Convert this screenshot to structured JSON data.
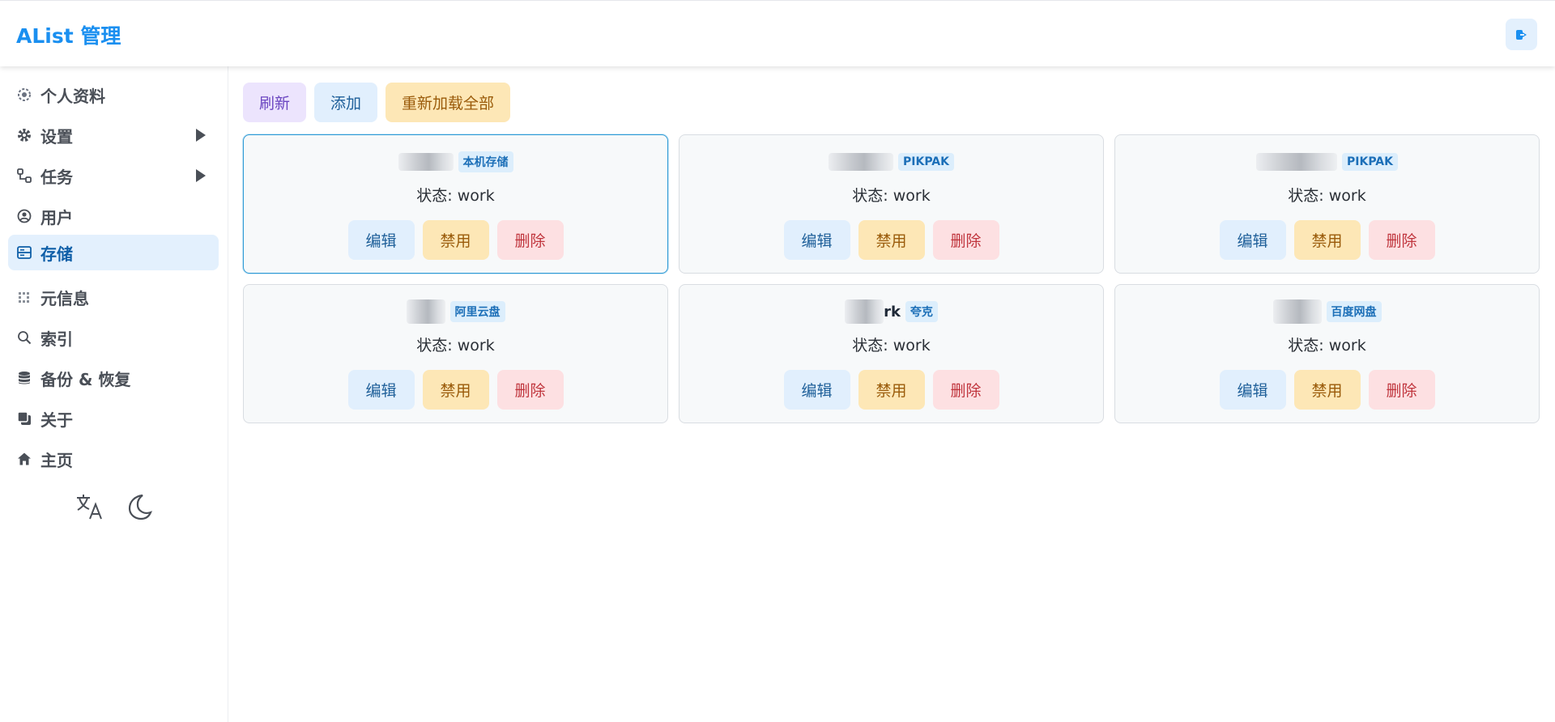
{
  "header": {
    "title": "AList 管理"
  },
  "sidebar": {
    "items": [
      {
        "label": "个人资料",
        "icon": "user-cog-icon",
        "has_submenu": false
      },
      {
        "label": "设置",
        "icon": "gear-icon",
        "has_submenu": true
      },
      {
        "label": "任务",
        "icon": "flow-icon",
        "has_submenu": true
      },
      {
        "label": "用户",
        "icon": "user-circle-icon",
        "has_submenu": false
      },
      {
        "label": "存储",
        "icon": "storage-icon",
        "has_submenu": false,
        "active": true
      },
      {
        "label": "元信息",
        "icon": "meta-grid-icon",
        "has_submenu": false
      },
      {
        "label": "索引",
        "icon": "search-icon",
        "has_submenu": false
      },
      {
        "label": "备份 & 恢复",
        "icon": "database-icon",
        "has_submenu": false
      },
      {
        "label": "关于",
        "icon": "copy-icon",
        "has_submenu": false
      },
      {
        "label": "主页",
        "icon": "home-icon",
        "has_submenu": false
      }
    ]
  },
  "toolbar": {
    "refresh_label": "刷新",
    "add_label": "添加",
    "reload_all_label": "重新加载全部"
  },
  "storages": [
    {
      "driver": "本机存储",
      "mount_suffix": "",
      "status": "状态: work"
    },
    {
      "driver": "PIKPAK",
      "mount_suffix": "",
      "status": "状态: work"
    },
    {
      "driver": "PIKPAK",
      "mount_suffix": "",
      "status": "状态: work"
    },
    {
      "driver": "阿里云盘",
      "mount_suffix": "",
      "status": "状态: work"
    },
    {
      "driver": "夸克",
      "mount_suffix": "rk",
      "status": "状态: work"
    },
    {
      "driver": "百度网盘",
      "mount_suffix": "",
      "status": "状态: work"
    }
  ],
  "card_actions": {
    "edit": "编辑",
    "disable": "禁用",
    "delete": "删除"
  },
  "colors": {
    "accent": "#1a8ff0",
    "active_bg": "#e3f0fd",
    "edit_bg": "#e1effd",
    "disable_bg": "#fde7b6",
    "delete_bg": "#fde0e2"
  }
}
